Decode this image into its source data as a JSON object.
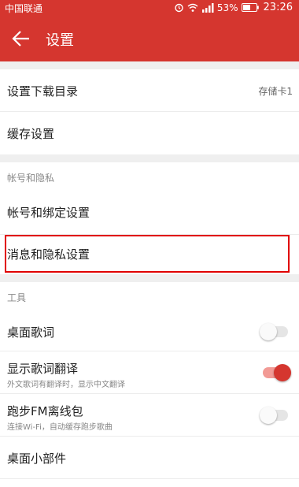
{
  "status_bar": {
    "carrier": "中国联通",
    "battery_percent": "53%",
    "time": "23:26",
    "signal_label": "4G"
  },
  "app_bar": {
    "title": "设置",
    "back_icon": "arrow-left-icon"
  },
  "storage": {
    "download_dir_label": "设置下载目录",
    "download_dir_value": "存储卡1",
    "cache_label": "缓存设置"
  },
  "account_section": {
    "header": "帐号和隐私",
    "items": [
      {
        "label": "帐号和绑定设置"
      },
      {
        "label": "消息和隐私设置"
      }
    ]
  },
  "tools_section": {
    "header": "工具",
    "items": [
      {
        "label": "桌面歌词",
        "sublabel": "",
        "toggle": "off"
      },
      {
        "label": "显示歌词翻译",
        "sublabel": "外文歌词有翻译时，显示中文翻译",
        "toggle": "on"
      },
      {
        "label": "跑步FM离线包",
        "sublabel": "连接Wi-Fi，自动缓存跑步歌曲",
        "toggle": "off"
      },
      {
        "label": "桌面小部件",
        "sublabel": "",
        "toggle": null
      }
    ]
  },
  "colors": {
    "accent": "#d5362f",
    "highlight_box": "#e00000"
  }
}
